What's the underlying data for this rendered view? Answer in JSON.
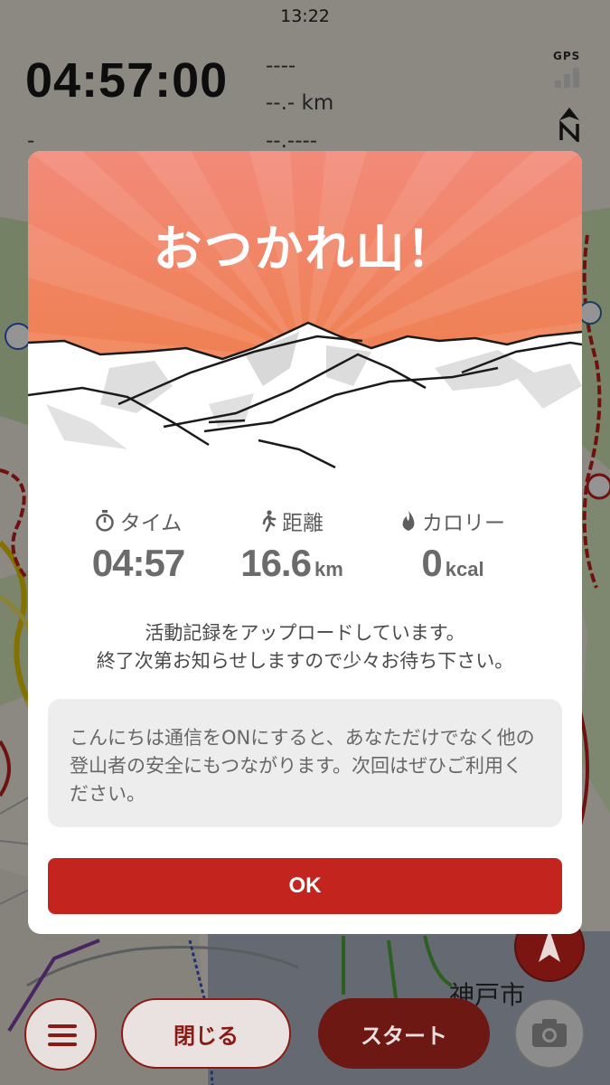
{
  "status_bar": {
    "time": "13:22"
  },
  "header": {
    "elapsed_time": "04:57:00",
    "stat_a": "----",
    "stat_b": "--.- km",
    "stat_c": "--.----",
    "stat_d": "-",
    "gps_label": "GPS"
  },
  "map": {
    "city_label": "神戸市"
  },
  "dialog": {
    "title": "おつかれ山！",
    "stats": [
      {
        "label": "タイム",
        "value": "04:57",
        "unit": "",
        "icon": "stopwatch-icon"
      },
      {
        "label": "距離",
        "value": "16.6",
        "unit": "km",
        "icon": "walker-icon"
      },
      {
        "label": "カロリー",
        "value": "0",
        "unit": "kcal",
        "icon": "flame-icon"
      }
    ],
    "upload_message_line1": "活動記録をアップロードしています。",
    "upload_message_line2": "終了次第お知らせしますので少々お待ち下さい。",
    "info_message": "こんにちは通信をONにすると、あなただけでなく他の登山者の安全にもつながります。次回はぜひご利用ください。",
    "ok_label": "OK"
  },
  "toolbar": {
    "close_label": "閉じる",
    "start_label": "スタート"
  },
  "colors": {
    "accent_red": "#c3241e",
    "dark_red": "#8b1a14",
    "sunrise_top": "#f28a7a",
    "sunrise_bottom": "#ee7a3a"
  }
}
